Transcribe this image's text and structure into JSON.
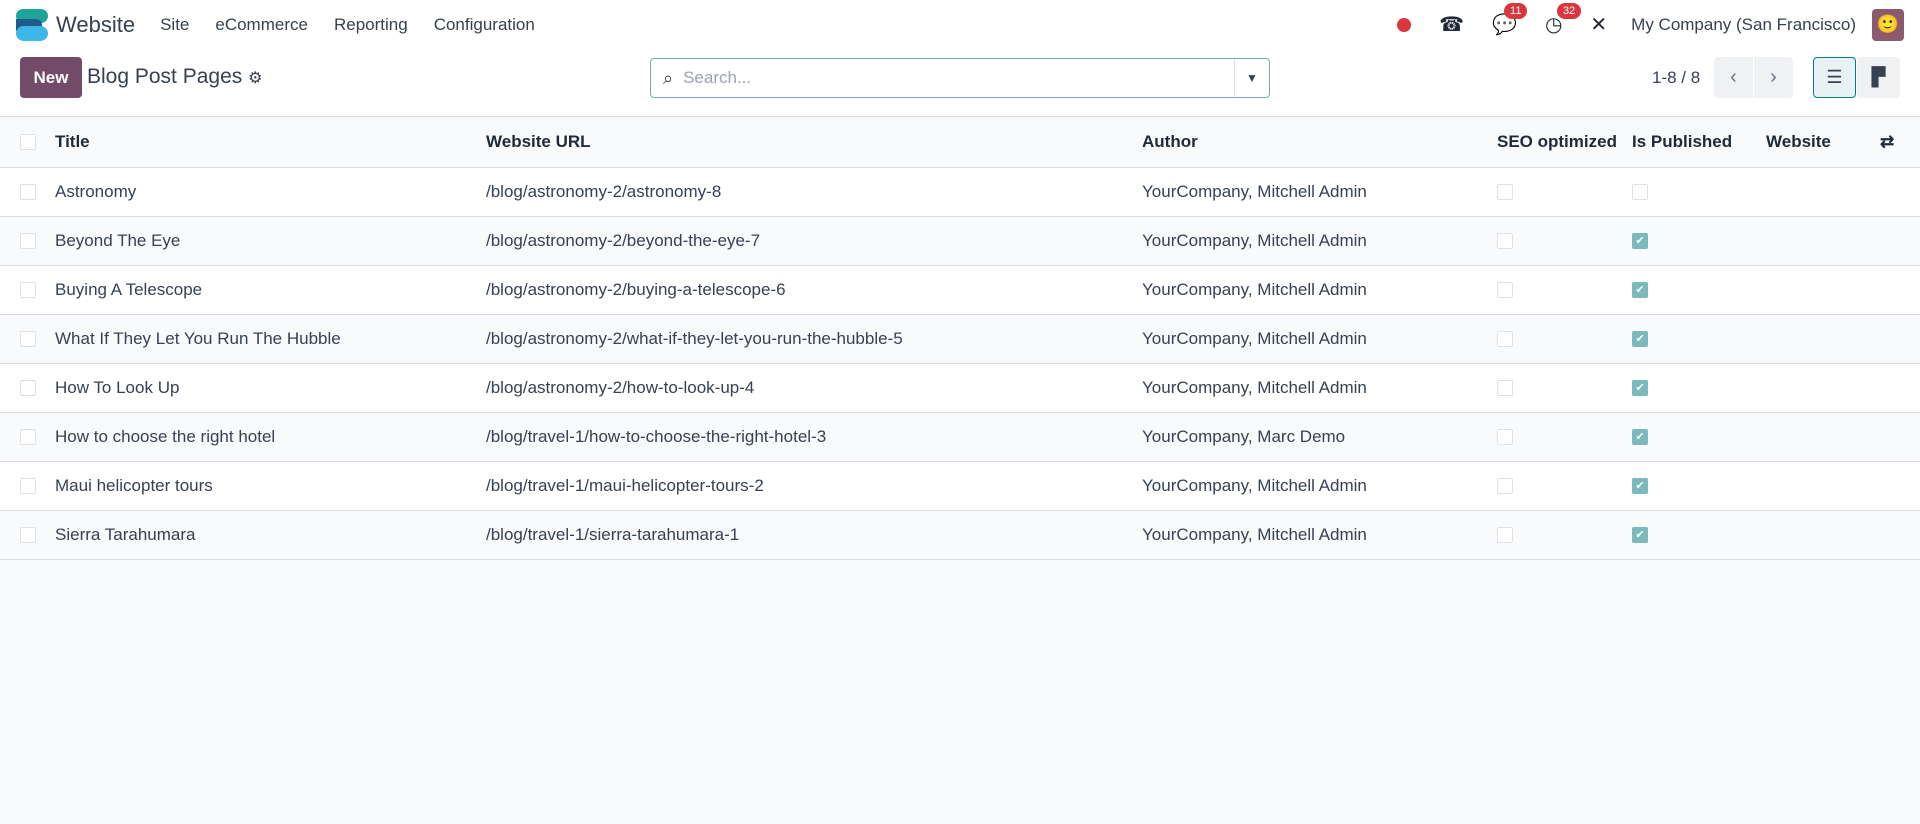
{
  "nav": {
    "app_name": "Website",
    "menus": [
      "Site",
      "eCommerce",
      "Reporting",
      "Configuration"
    ],
    "messages_count": "11",
    "activities_count": "32",
    "company": "My Company (San Francisco)"
  },
  "control": {
    "new_label": "New",
    "title": "Blog Post Pages",
    "search_placeholder": "Search...",
    "pager": "1-8 / 8"
  },
  "table": {
    "columns": [
      "Title",
      "Website URL",
      "Author",
      "SEO optimized",
      "Is Published",
      "Website"
    ],
    "rows": [
      {
        "title": "Astronomy",
        "url": "/blog/astronomy-2/astronomy-8",
        "author": "YourCompany, Mitchell Admin",
        "seo": false,
        "published": false
      },
      {
        "title": "Beyond The Eye",
        "url": "/blog/astronomy-2/beyond-the-eye-7",
        "author": "YourCompany, Mitchell Admin",
        "seo": false,
        "published": true
      },
      {
        "title": "Buying A Telescope",
        "url": "/blog/astronomy-2/buying-a-telescope-6",
        "author": "YourCompany, Mitchell Admin",
        "seo": false,
        "published": true
      },
      {
        "title": "What If They Let You Run The Hubble",
        "url": "/blog/astronomy-2/what-if-they-let-you-run-the-hubble-5",
        "author": "YourCompany, Mitchell Admin",
        "seo": false,
        "published": true
      },
      {
        "title": "How To Look Up",
        "url": "/blog/astronomy-2/how-to-look-up-4",
        "author": "YourCompany, Mitchell Admin",
        "seo": false,
        "published": true
      },
      {
        "title": "How to choose the right hotel",
        "url": "/blog/travel-1/how-to-choose-the-right-hotel-3",
        "author": "YourCompany, Marc Demo",
        "seo": false,
        "published": true
      },
      {
        "title": "Maui helicopter tours",
        "url": "/blog/travel-1/maui-helicopter-tours-2",
        "author": "YourCompany, Mitchell Admin",
        "seo": false,
        "published": true
      },
      {
        "title": "Sierra Tarahumara",
        "url": "/blog/travel-1/sierra-tarahumara-1",
        "author": "YourCompany, Mitchell Admin",
        "seo": false,
        "published": true
      }
    ]
  },
  "colors": {
    "brand": "#714b67",
    "checked": "#7cb9bb",
    "badge": "#d9363e"
  }
}
